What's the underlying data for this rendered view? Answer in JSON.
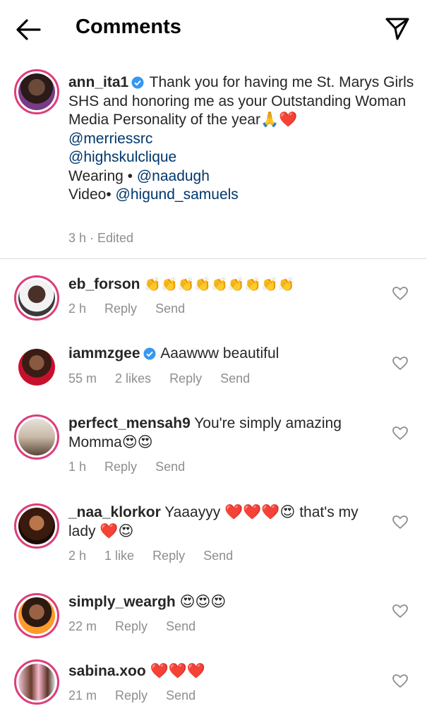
{
  "header": {
    "title": "Comments"
  },
  "caption": {
    "username": "ann_ita1",
    "text": "Thank you for having me St. Marys Girls SHS and honoring me as your Outstanding Woman Media Personality of the year",
    "emoji": "🙏❤️",
    "mention1": "@merriessrc",
    "mention2": "@highskulclique",
    "wearing_label": "Wearing • ",
    "wearing_mention": "@naadugh",
    "video_label": "Video• ",
    "video_mention": "@higund_samuels",
    "time": "3 h · Edited"
  },
  "comments": [
    {
      "username": "eb_forson",
      "text": "👏👏👏👏👏👏👏👏👏",
      "time": "2 h",
      "likes": "",
      "reply": "Reply",
      "send": "Send"
    },
    {
      "username": "iammzgee",
      "text": "Aaawww beautiful",
      "time": "55 m",
      "likes": "2 likes",
      "reply": "Reply",
      "send": "Send"
    },
    {
      "username": "perfect_mensah9",
      "text": "You're simply amazing Momma😍😍",
      "time": "1 h",
      "likes": "",
      "reply": "Reply",
      "send": "Send"
    },
    {
      "username": "_naa_klorkor",
      "text": "Yaaayyy ❤️❤️❤️😍 that's my lady ❤️😍",
      "time": "2 h",
      "likes": "1 like",
      "reply": "Reply",
      "send": "Send"
    },
    {
      "username": "simply_weargh",
      "text": "😍😍😍",
      "time": "22 m",
      "likes": "",
      "reply": "Reply",
      "send": "Send"
    },
    {
      "username": "sabina.xoo",
      "text": "❤️❤️❤️",
      "time": "21 m",
      "likes": "",
      "reply": "Reply",
      "send": "Send"
    }
  ],
  "colors": {
    "ring": "#dd3d7a",
    "verified": "#3897f0",
    "mention": "#00376b",
    "meta": "#8e8e8e"
  },
  "icons": {
    "back": "arrow-left-icon",
    "send": "paper-plane-icon",
    "like": "heart-outline-icon"
  }
}
